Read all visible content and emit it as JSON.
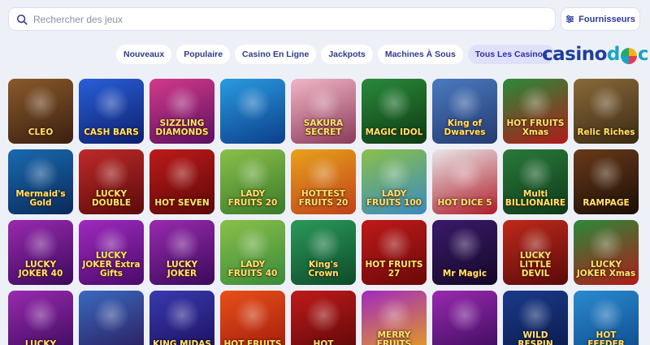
{
  "search": {
    "placeholder": "Rechercher des jeux"
  },
  "providers_button": {
    "label": "Fournisseurs"
  },
  "tabs": [
    {
      "label": "Nouveaux",
      "active": false
    },
    {
      "label": "Populaire",
      "active": false
    },
    {
      "label": "Casino En Ligne",
      "active": false
    },
    {
      "label": "Jackpots",
      "active": false
    },
    {
      "label": "Machines À Sous",
      "active": false
    },
    {
      "label": "Tous Les Casinos",
      "active": true
    }
  ],
  "logo": {
    "part1": "casino",
    "part2": "d",
    "part3": "c"
  },
  "games": [
    {
      "name": "CLEO",
      "bg1": "#8a5a2b",
      "bg2": "#3a1f10"
    },
    {
      "name": "CASH BARS",
      "bg1": "#2a5fd9",
      "bg2": "#0d1f6e"
    },
    {
      "name": "SIZZLING DIAMONDS",
      "bg1": "#d43a8a",
      "bg2": "#5a1060"
    },
    {
      "name": "",
      "bg1": "#2a9be0",
      "bg2": "#0b3f8a"
    },
    {
      "name": "SAKURA SECRET",
      "bg1": "#f2b6c6",
      "bg2": "#8a3a5a"
    },
    {
      "name": "MAGIC IDOL",
      "bg1": "#2a8a3a",
      "bg2": "#0e3a14"
    },
    {
      "name": "King of Dwarves",
      "bg1": "#4a7ac0",
      "bg2": "#243a70"
    },
    {
      "name": "HOT FRUITS Xmas",
      "bg1": "#2a8a3a",
      "bg2": "#b01a1a"
    },
    {
      "name": "Relic Riches",
      "bg1": "#8a6a3a",
      "bg2": "#3a2a12"
    },
    {
      "name": "Mermaid's Gold",
      "bg1": "#1a6ab0",
      "bg2": "#0a2a5a"
    },
    {
      "name": "LUCKY DOUBLE",
      "bg1": "#c02a2a",
      "bg2": "#5a0a0a"
    },
    {
      "name": "HOT SEVEN",
      "bg1": "#c01a1a",
      "bg2": "#5a0808"
    },
    {
      "name": "LADY FRUITS 20",
      "bg1": "#8ac04a",
      "bg2": "#3a7a2a"
    },
    {
      "name": "HOTTEST FRUITS 20",
      "bg1": "#e8a21a",
      "bg2": "#c0401a"
    },
    {
      "name": "LADY FRUITS 100",
      "bg1": "#8ac04a",
      "bg2": "#3a8ac0"
    },
    {
      "name": "HOT DICE 5",
      "bg1": "#e8e8e8",
      "bg2": "#b01a2a"
    },
    {
      "name": "Multi BILLIONAIRE",
      "bg1": "#2a7a3a",
      "bg2": "#0e3a1a"
    },
    {
      "name": "RAMPAGE",
      "bg1": "#6a3a1a",
      "bg2": "#1a0e06"
    },
    {
      "name": "LUCKY JOKER 40",
      "bg1": "#9a2ab0",
      "bg2": "#3a0a5a"
    },
    {
      "name": "LUCKY JOKER Extra Gifts",
      "bg1": "#a02ac0",
      "bg2": "#4a0a6a"
    },
    {
      "name": "LUCKY JOKER",
      "bg1": "#9a2ab0",
      "bg2": "#3a0a5a"
    },
    {
      "name": "LADY FRUITS 40",
      "bg1": "#8ac04a",
      "bg2": "#3a8a3a"
    },
    {
      "name": "King's Crown",
      "bg1": "#2a9a5a",
      "bg2": "#0e4a2a"
    },
    {
      "name": "HOT FRUITS 27",
      "bg1": "#c01a1a",
      "bg2": "#6a0808"
    },
    {
      "name": "Mr Magic",
      "bg1": "#3a1a6a",
      "bg2": "#140828"
    },
    {
      "name": "LUCKY LITTLE DEVIL",
      "bg1": "#c02a1a",
      "bg2": "#5a0a0a"
    },
    {
      "name": "LUCKY JOKER Xmas",
      "bg1": "#2a8a3a",
      "bg2": "#b01a1a"
    },
    {
      "name": "LUCKY",
      "bg1": "#9a2ab0",
      "bg2": "#3a0a5a"
    },
    {
      "name": "",
      "bg1": "#3a6ac0",
      "bg2": "#2a1a5a"
    },
    {
      "name": "KING MIDAS",
      "bg1": "#3a3ab0",
      "bg2": "#1a0e5a"
    },
    {
      "name": "HOT FRUITS",
      "bg1": "#e8501a",
      "bg2": "#a01a0a"
    },
    {
      "name": "HOT",
      "bg1": "#c01a1a",
      "bg2": "#5a0808"
    },
    {
      "name": "MERRY FRUITS",
      "bg1": "#a02ac0",
      "bg2": "#e8a21a"
    },
    {
      "name": "",
      "bg1": "#9a2ab0",
      "bg2": "#3a0a5a"
    },
    {
      "name": "WILD RESPIN",
      "bg1": "#1a3a8a",
      "bg2": "#0a1a4a"
    },
    {
      "name": "HOT FEEDER",
      "bg1": "#2a8ad0",
      "bg2": "#0e4a8a"
    }
  ]
}
